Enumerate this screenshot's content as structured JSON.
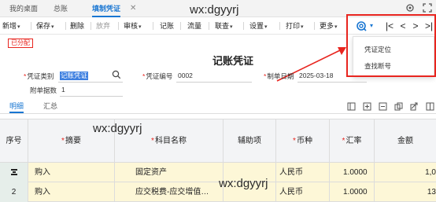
{
  "tabs": [
    {
      "label": "我的桌面"
    },
    {
      "label": "总账"
    },
    {
      "label": "填制凭证"
    }
  ],
  "tab_close": "✕",
  "watermarks": [
    "wx:dgyyrj",
    "wx:dgyyrj",
    "wx:dgyyrj"
  ],
  "toolbar": {
    "add": "新增",
    "save": "保存",
    "delete": "删除",
    "discard": "放弃",
    "review": "审核",
    "post": "记账",
    "flow": "流量",
    "query": "联查",
    "settings": "设置",
    "print": "打印",
    "more": "更多"
  },
  "nav": {
    "first": "|<",
    "prev": "<",
    "next": ">",
    "last": ">|"
  },
  "dropdown": {
    "items": [
      "凭证定位",
      "查找断号"
    ]
  },
  "status_badge": "已分配",
  "document_title": "记账凭证",
  "header": {
    "voucher_type_label": "凭证类别",
    "voucher_type_value": "记账凭证",
    "voucher_no_label": "凭证编号",
    "voucher_no_value": "0002",
    "date_label": "制单日期",
    "date_value": "2025-03-18",
    "attachments_label": "附单据数",
    "attachments_value": "1"
  },
  "subtabs": [
    "明细",
    "汇总"
  ],
  "grid": {
    "columns": [
      "序号",
      "摘要",
      "科目名称",
      "辅助项",
      "币种",
      "汇率",
      "金额"
    ],
    "required_columns": [
      false,
      true,
      true,
      false,
      true,
      true,
      false
    ],
    "rows": [
      {
        "seq": "",
        "summary": "购入",
        "account": "固定资产",
        "aux": "",
        "currency": "人民币",
        "rate": "1.0000",
        "amount": "1,0"
      },
      {
        "seq": "2",
        "summary": "购入",
        "account": "应交税费-应交增值…",
        "aux": "",
        "currency": "人民币",
        "rate": "1.0000",
        "amount": "13"
      }
    ]
  },
  "colors": {
    "accent": "#1976d2",
    "highlight_red": "#e8251f",
    "row_highlight": "#fdf7d7"
  }
}
